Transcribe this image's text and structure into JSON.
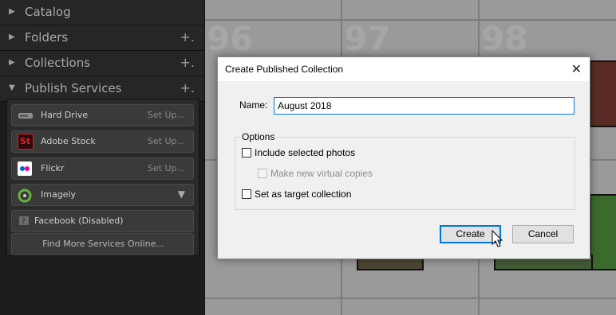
{
  "left_panel": {
    "sections": [
      {
        "label": "Catalog",
        "expanded": false,
        "has_plus": false
      },
      {
        "label": "Folders",
        "expanded": false,
        "has_plus": true
      },
      {
        "label": "Collections",
        "expanded": false,
        "has_plus": true
      },
      {
        "label": "Publish Services",
        "expanded": true,
        "has_plus": true
      }
    ],
    "plus_symbol": "+.",
    "services": [
      {
        "name": "Hard Drive",
        "action": "Set Up...",
        "icon": "hard-drive-icon"
      },
      {
        "name": "Adobe Stock",
        "action": "Set Up...",
        "icon": "adobe-stock-icon",
        "icon_text": "St"
      },
      {
        "name": "Flickr",
        "action": "Set Up...",
        "icon": "flickr-icon"
      },
      {
        "name": "Imagely",
        "action": "▼",
        "icon": "imagely-icon"
      },
      {
        "name": "Facebook (Disabled)",
        "action": "",
        "icon": "facebook-disabled-icon"
      }
    ],
    "find_more_label": "Find More Services Online..."
  },
  "grid": {
    "cell_numbers": [
      "96",
      "97",
      "98"
    ]
  },
  "dialog": {
    "title": "Create Published Collection",
    "close_symbol": "✕",
    "name_label": "Name:",
    "name_value": "August 2018",
    "options_label": "Options",
    "checkboxes": [
      {
        "label": "Include selected photos",
        "checked": false,
        "enabled": true
      },
      {
        "label": "Make new virtual copies",
        "checked": false,
        "enabled": false
      },
      {
        "label": "Set as target collection",
        "checked": false,
        "enabled": true
      }
    ],
    "create_label": "Create",
    "cancel_label": "Cancel"
  },
  "colors": {
    "panel_bg": "#1c1c1c",
    "accent_blue": "#0078d7",
    "adobe_stock_red": "#da1f26"
  }
}
